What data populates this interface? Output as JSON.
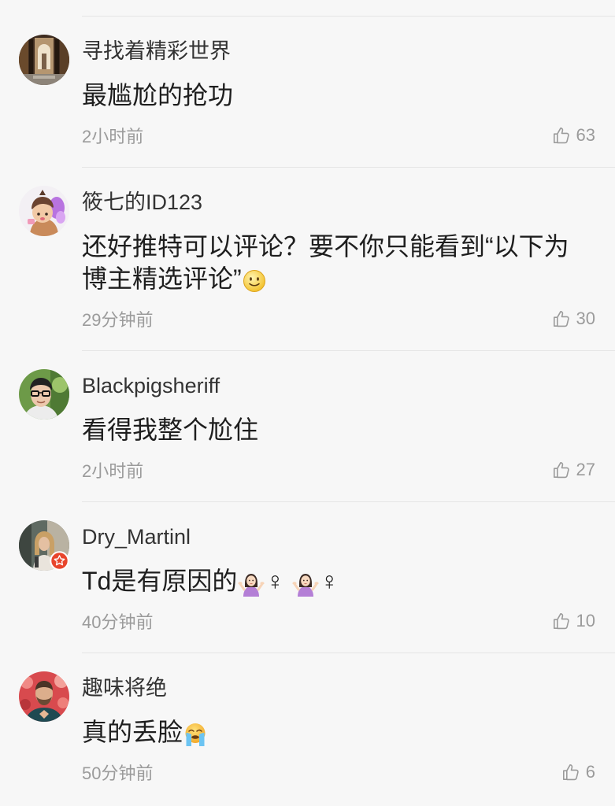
{
  "colors": {
    "background": "#f7f7f7",
    "divider": "#e5e5e5",
    "username": "#333333",
    "content": "#1e1e1e",
    "meta": "#9b9b9b",
    "badge": "#e8452c"
  },
  "like_icon": "thumbs-up-icon",
  "comments": [
    {
      "username": "寻找着精彩世界",
      "content": [
        {
          "text": "最尴尬的抢功"
        }
      ],
      "time": "2小时前",
      "likes": 63
    },
    {
      "username": "筱七的ID123",
      "content": [
        {
          "text": "还好推特可以评论？要不你只能看到“以下为博主精选评论”"
        },
        {
          "emoji": "slightly-smiling-face-icon"
        }
      ],
      "time": "29分钟前",
      "likes": 30
    },
    {
      "username": "Blackpigsheriff",
      "content": [
        {
          "text": "看得我整个尬住"
        }
      ],
      "time": "2小时前",
      "likes": 27
    },
    {
      "username": "Dry_Martinl",
      "badge": "star-badge-icon",
      "content": [
        {
          "text": "Td是有原因的"
        },
        {
          "emoji": "woman-shrugging-icon"
        },
        {
          "text": "♀ "
        },
        {
          "emoji": "woman-shrugging-icon"
        },
        {
          "text": "♀"
        }
      ],
      "time": "40分钟前",
      "likes": 10
    },
    {
      "username": "趣味将绝",
      "content": [
        {
          "text": "真的丢脸"
        },
        {
          "emoji": "loudly-crying-face-icon"
        }
      ],
      "time": "50分钟前",
      "likes": 6
    }
  ]
}
